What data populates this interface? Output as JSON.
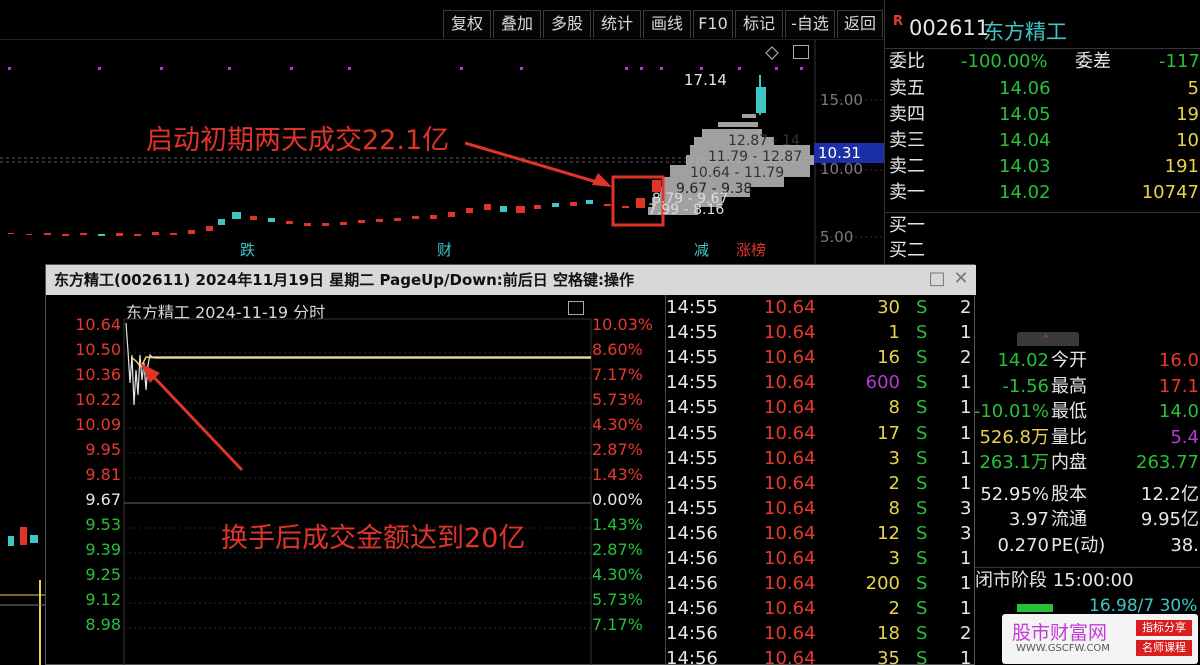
{
  "toolbar": {
    "buttons": [
      "复权",
      "叠加",
      "多股",
      "统计",
      "画线",
      "F10",
      "标记",
      "-自选",
      "返回"
    ]
  },
  "kline": {
    "price_axis": [
      "15.00",
      "10.00",
      "5.00"
    ],
    "current_price_tag": "10.31",
    "peak_label": "17.14",
    "range_labels": [
      "12.87 - 14",
      "11.79 - 12.87",
      "10.64 - 11.79",
      "9.67 - 9.38",
      "8.79 - 9.67",
      "7.99 - 8.16"
    ],
    "annotation": "启动初期两天成交22.1亿",
    "event_tags": [
      "跌",
      "财",
      "减",
      "涨榜"
    ]
  },
  "quote_panel": {
    "r_badge": "R",
    "code": "002611",
    "name": "东方精工",
    "weibi_label": "委比",
    "weibi_value": "-100.00%",
    "weicha_label": "委差",
    "weicha_value": "-117",
    "asks": [
      {
        "label": "卖五",
        "price": "14.06",
        "vol": "5"
      },
      {
        "label": "卖四",
        "price": "14.05",
        "vol": "19"
      },
      {
        "label": "卖三",
        "price": "14.04",
        "vol": "10"
      },
      {
        "label": "卖二",
        "price": "14.03",
        "vol": "191"
      },
      {
        "label": "卖一",
        "price": "14.02",
        "vol": "10747"
      }
    ],
    "bids": [
      {
        "label": "买一"
      },
      {
        "label": "买二"
      }
    ],
    "stats": [
      {
        "v1": "14.02",
        "l2": "今开",
        "v2": "16.0"
      },
      {
        "v1": "-1.56",
        "l2": "最高",
        "v2": "17.1"
      },
      {
        "v1": "-10.01%",
        "l2": "最低",
        "v2": "14.0"
      },
      {
        "v1": "526.8万",
        "l2": "量比",
        "v2": "5.4"
      },
      {
        "v1": "263.1万",
        "l2": "内盘",
        "v2": "263.77"
      },
      {
        "v1": "52.95%",
        "l2": "股本",
        "v2": "12.2亿"
      },
      {
        "v1": "3.97",
        "l2": "流通",
        "v2": "9.95亿"
      },
      {
        "v1": "0.270",
        "l2": "PE(动)",
        "v2": "38."
      }
    ],
    "phase": "闭市阶段 15:00:00",
    "bottom_partial": "16.98/7  30%"
  },
  "popup": {
    "title": "东方精工(002611) 2024年11月19日 星期二 PageUp/Down:前后日 空格键:操作",
    "chart_header": "东方精工   2024-11-19 分时",
    "annotation": "换手后成交金额达到20亿",
    "y_left": [
      "10.64",
      "10.50",
      "10.36",
      "10.22",
      "10.09",
      "9.95",
      "9.81",
      "9.67",
      "9.53",
      "9.39",
      "9.25",
      "9.12",
      "8.98"
    ],
    "y_right": [
      "10.03%",
      "8.60%",
      "7.17%",
      "5.73%",
      "4.30%",
      "2.87%",
      "1.43%",
      "0.00%",
      "1.43%",
      "2.87%",
      "4.30%",
      "5.73%",
      "7.17%"
    ],
    "ticks": [
      {
        "time": "14:55",
        "price": "10.64",
        "vol": "30",
        "side": "S",
        "n": "2"
      },
      {
        "time": "14:55",
        "price": "10.64",
        "vol": "1",
        "side": "S",
        "n": "1"
      },
      {
        "time": "14:55",
        "price": "10.64",
        "vol": "16",
        "side": "S",
        "n": "2"
      },
      {
        "time": "14:55",
        "price": "10.64",
        "vol": "600",
        "side": "S",
        "n": "1"
      },
      {
        "time": "14:55",
        "price": "10.64",
        "vol": "8",
        "side": "S",
        "n": "1"
      },
      {
        "time": "14:55",
        "price": "10.64",
        "vol": "17",
        "side": "S",
        "n": "1"
      },
      {
        "time": "14:55",
        "price": "10.64",
        "vol": "3",
        "side": "S",
        "n": "1"
      },
      {
        "time": "14:55",
        "price": "10.64",
        "vol": "2",
        "side": "S",
        "n": "1"
      },
      {
        "time": "14:55",
        "price": "10.64",
        "vol": "8",
        "side": "S",
        "n": "3"
      },
      {
        "time": "14:56",
        "price": "10.64",
        "vol": "12",
        "side": "S",
        "n": "3"
      },
      {
        "time": "14:56",
        "price": "10.64",
        "vol": "3",
        "side": "S",
        "n": "1"
      },
      {
        "time": "14:56",
        "price": "10.64",
        "vol": "200",
        "side": "S",
        "n": "1"
      },
      {
        "time": "14:56",
        "price": "10.64",
        "vol": "2",
        "side": "S",
        "n": "1"
      },
      {
        "time": "14:56",
        "price": "10.64",
        "vol": "18",
        "side": "S",
        "n": "2"
      },
      {
        "time": "14:56",
        "price": "10.64",
        "vol": "35",
        "side": "S",
        "n": "1"
      }
    ]
  },
  "watermark": {
    "site": "股市财富网",
    "url": "WWW.GSCFW.COM",
    "badge1": "指标分享",
    "badge2": "名师课程"
  }
}
